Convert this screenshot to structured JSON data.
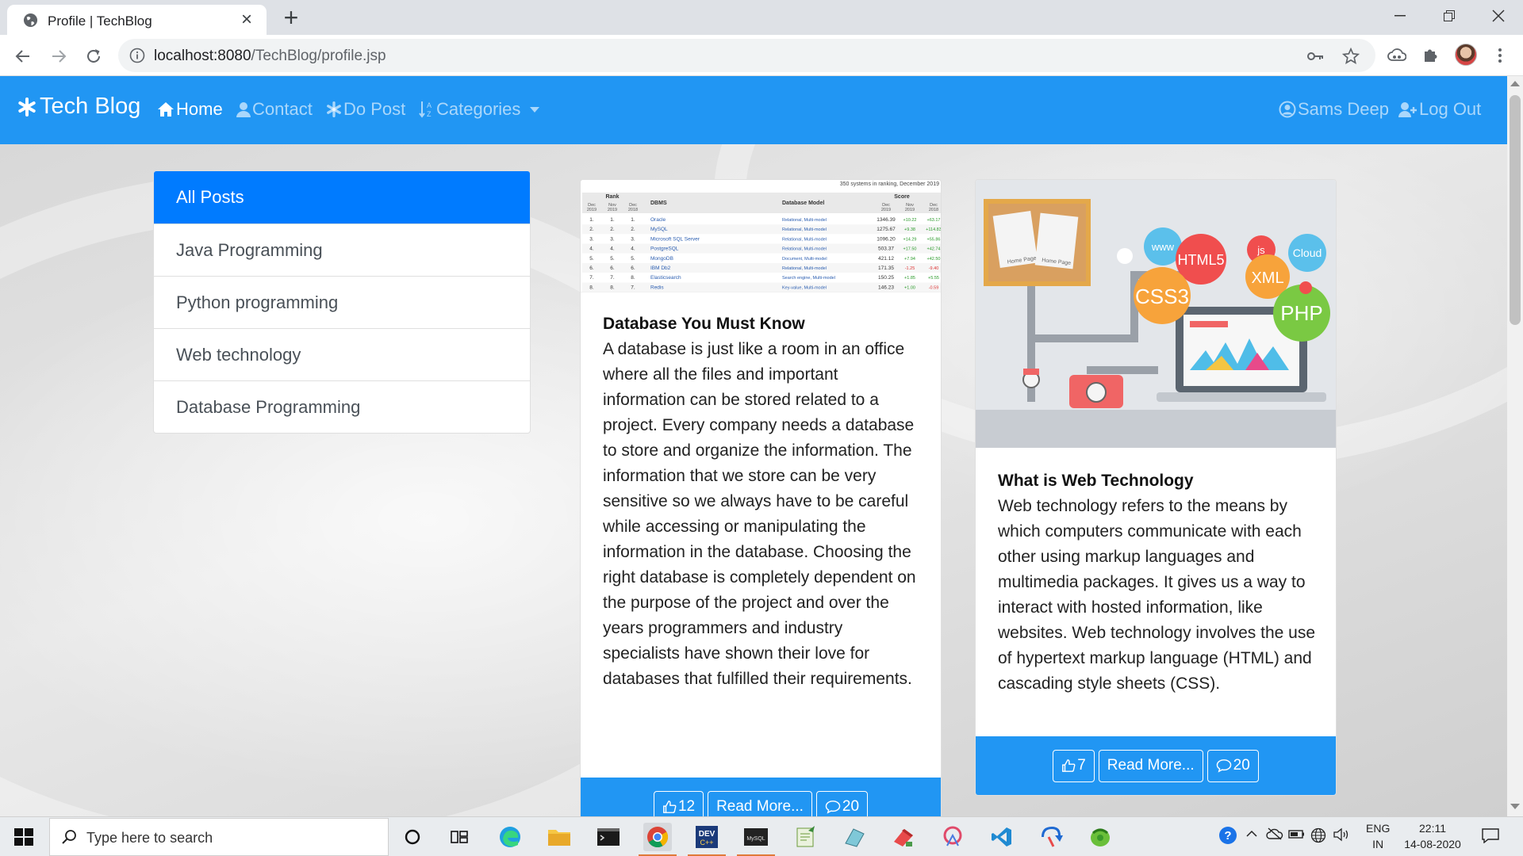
{
  "browser": {
    "tab_title": "Profile | TechBlog",
    "url_host": "localhost:8080",
    "url_path": "/TechBlog/profile.jsp"
  },
  "navbar": {
    "brand": "Tech Blog",
    "items": [
      {
        "label": "Home",
        "icon": "home-icon",
        "active": true
      },
      {
        "label": "Contact",
        "icon": "user-icon",
        "active": false
      },
      {
        "label": "Do Post",
        "icon": "asterisk-icon",
        "active": false
      },
      {
        "label": "Categories",
        "icon": "sort-alpha-icon",
        "active": false,
        "dropdown": true
      }
    ],
    "user": "Sams Deep",
    "logout": "Log Out"
  },
  "categories": [
    {
      "label": "All Posts",
      "active": true
    },
    {
      "label": "Java Programming",
      "active": false
    },
    {
      "label": "Python programming",
      "active": false
    },
    {
      "label": "Web technology",
      "active": false
    },
    {
      "label": "Database Programming",
      "active": false
    }
  ],
  "posts": [
    {
      "title": "Database You Must Know",
      "content": "A database is just like a room in an office where all the files and important information can be stored related to a project. Every company needs a database to store and organize the information. The information that we store can be very sensitive so we always have to be careful while accessing or manipulating the information in the database. Choosing the right database is completely dependent on the purpose of the project and over the years programmers and industry specialists have shown their love for databases that fulfilled their requirements.",
      "likes": "12",
      "read_more": "Read More...",
      "comments": "20",
      "image": {
        "caption": "350 systems in ranking, December 2019",
        "headers": [
          "Rank",
          "DBMS",
          "Database Model",
          "Score"
        ],
        "sub_headers": [
          "Dec 2019",
          "Nov 2019",
          "Dec 2018"
        ],
        "rows": [
          [
            "1.",
            "1.",
            "1.",
            "Oracle",
            "Relational, Multi-model",
            "1346.39",
            "+10.22",
            "+63.17"
          ],
          [
            "2.",
            "2.",
            "2.",
            "MySQL",
            "Relational, Multi-model",
            "1275.67",
            "+9.38",
            "+114.83"
          ],
          [
            "3.",
            "3.",
            "3.",
            "Microsoft SQL Server",
            "Relational, Multi-model",
            "1096.20",
            "+14.29",
            "+55.86"
          ],
          [
            "4.",
            "4.",
            "4.",
            "PostgreSQL",
            "Relational, Multi-model",
            "503.37",
            "+17.50",
            "+42.74"
          ],
          [
            "5.",
            "5.",
            "5.",
            "MongoDB",
            "Document, Multi-model",
            "421.12",
            "+7.94",
            "+42.50"
          ],
          [
            "6.",
            "6.",
            "6.",
            "IBM Db2",
            "Relational, Multi-model",
            "171.35",
            "-1.25",
            "-9.40"
          ],
          [
            "7.",
            "7.",
            "8.",
            "Elasticsearch",
            "Search engine, Multi-model",
            "150.25",
            "+1.85",
            "+5.55"
          ],
          [
            "8.",
            "8.",
            "7.",
            "Redis",
            "Key-value, Multi-model",
            "146.23",
            "+1.00",
            "-0.59"
          ]
        ]
      }
    },
    {
      "title": "What is Web Technology",
      "content": "Web technology refers to the means by which computers communicate with each other using markup languages and multimedia packages. It gives us a way to interact with hosted information, like websites. Web technology involves the use of hypertext markup language (HTML) and cascading style sheets (CSS).",
      "likes": "7",
      "read_more": "Read More...",
      "comments": "20",
      "image": {
        "bubbles": [
          "www",
          "HTML5",
          "js",
          "Cloud",
          "CSS3",
          "XML",
          "PHP"
        ],
        "pages": [
          "Home Page",
          "Home Page"
        ]
      }
    }
  ],
  "taskbar": {
    "search_placeholder": "Type here to search",
    "apps": [
      "cortana-icon",
      "task-view-icon",
      "edge-icon",
      "file-explorer-icon",
      "terminal-icon",
      "chrome-icon",
      "devc-icon",
      "mysql-icon",
      "notepad-icon",
      "app-icon",
      "app-icon",
      "app-icon",
      "vscode-icon",
      "app-icon",
      "app-icon"
    ],
    "lang_top": "ENG",
    "lang_bottom": "IN",
    "time": "22:11",
    "date": "14-08-2020"
  },
  "colors": {
    "primary": "#2196f3",
    "active_list": "#007bff"
  }
}
